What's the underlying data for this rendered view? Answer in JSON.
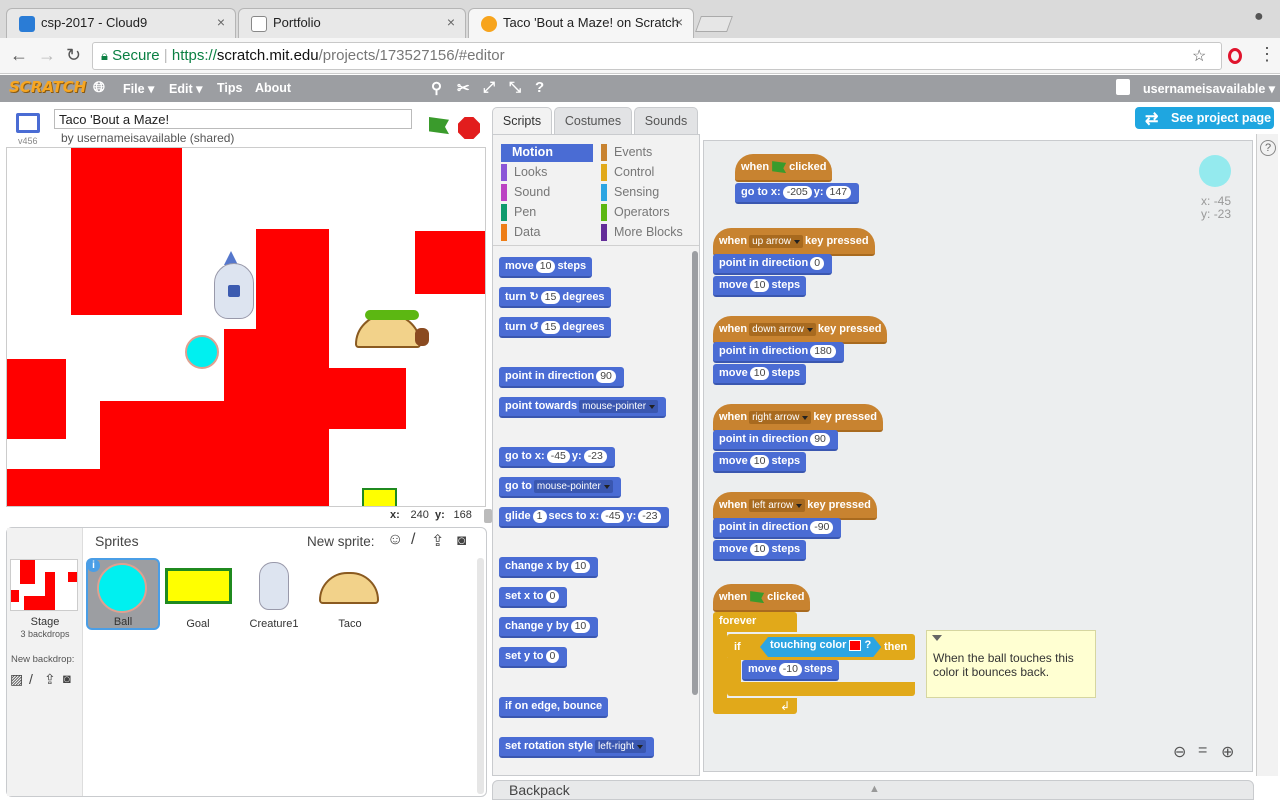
{
  "browser": {
    "tabs": [
      {
        "label": "csp-2017 - Cloud9",
        "icon": "cloud9-icon"
      },
      {
        "label": "Portfolio",
        "icon": "page-icon"
      },
      {
        "label": "Taco 'Bout a Maze! on Scratch",
        "icon": "scratch-icon"
      }
    ],
    "url_secure": "Secure",
    "url_scheme": "https://",
    "url_host": "scratch.mit.edu",
    "url_path": "/projects/173527156/#editor"
  },
  "menubar": {
    "logo": "SCRATCH",
    "file": "File ▾",
    "edit": "Edit ▾",
    "tips": "Tips",
    "about": "About",
    "username": "usernameisavailable ▾"
  },
  "project": {
    "title": "Taco 'Bout a Maze!",
    "author": "by usernameisavailable (shared)",
    "version": "v456",
    "see_project": "See project page"
  },
  "stage": {
    "mouse_x_label": "x:",
    "mouse_x": "240",
    "mouse_y_label": "y:",
    "mouse_y": "168"
  },
  "sprites": {
    "header": "Sprites",
    "new_sprite": "New sprite:",
    "stage_label": "Stage",
    "backdrops": "3 backdrops",
    "new_backdrop": "New backdrop:",
    "items": [
      "Ball",
      "Goal",
      "Creature1",
      "Taco"
    ]
  },
  "tabs": {
    "scripts": "Scripts",
    "costumes": "Costumes",
    "sounds": "Sounds"
  },
  "categories": [
    {
      "label": "Motion",
      "color": "#4a6cd4"
    },
    {
      "label": "Looks",
      "color": "#8a55d7"
    },
    {
      "label": "Sound",
      "color": "#bb42c3"
    },
    {
      "label": "Pen",
      "color": "#0e9a6c"
    },
    {
      "label": "Data",
      "color": "#ee7d16"
    },
    {
      "label": "Events",
      "color": "#c88330"
    },
    {
      "label": "Control",
      "color": "#e1a91a"
    },
    {
      "label": "Sensing",
      "color": "#2ca5e2"
    },
    {
      "label": "Operators",
      "color": "#5cb712"
    },
    {
      "label": "More Blocks",
      "color": "#632d99"
    }
  ],
  "palette": {
    "move": "move",
    "move_n": "10",
    "steps": "steps",
    "turn": "turn",
    "turn_r_n": "15",
    "turn_l_n": "15",
    "degrees": "degrees",
    "point_dir": "point in direction",
    "point_dir_n": "90",
    "point_towards": "point towards",
    "point_towards_v": "mouse-pointer",
    "goto_xy": "go to x:",
    "goto_x": "-45",
    "y_label": "y:",
    "goto_y": "-23",
    "goto": "go to",
    "goto_v": "mouse-pointer",
    "glide": "glide",
    "glide_n": "1",
    "secs_to_x": "secs to x:",
    "glide_x": "-45",
    "glide_y": "-23",
    "change_x": "change x by",
    "change_x_n": "10",
    "set_x": "set x to",
    "set_x_n": "0",
    "change_y": "change y by",
    "change_y_n": "10",
    "set_y": "set y to",
    "set_y_n": "0",
    "bounce": "if on edge, bounce",
    "rotation": "set rotation style",
    "rotation_v": "left-right"
  },
  "scripts": {
    "when": "when",
    "clicked": "clicked",
    "key_pressed": "key pressed",
    "goto_x": "go to x:",
    "goto_xv": "-205",
    "y": "y:",
    "goto_yv": "147",
    "up": "up arrow",
    "down": "down arrow",
    "right": "right arrow",
    "left": "left arrow",
    "point": "point in direction",
    "dir_up": "0",
    "dir_down": "180",
    "dir_right": "90",
    "dir_left": "-90",
    "move": "move",
    "move_n": "10",
    "steps": "steps",
    "forever": "forever",
    "if": "if",
    "touching": "touching color",
    "q": "?",
    "then": "then",
    "move_neg": "-10",
    "comment": "When the ball touches this color it bounces back."
  },
  "sprite_info": {
    "x_label": "x:",
    "x": "-45",
    "y_label": "y:",
    "y": "-23"
  },
  "backpack": "Backpack"
}
